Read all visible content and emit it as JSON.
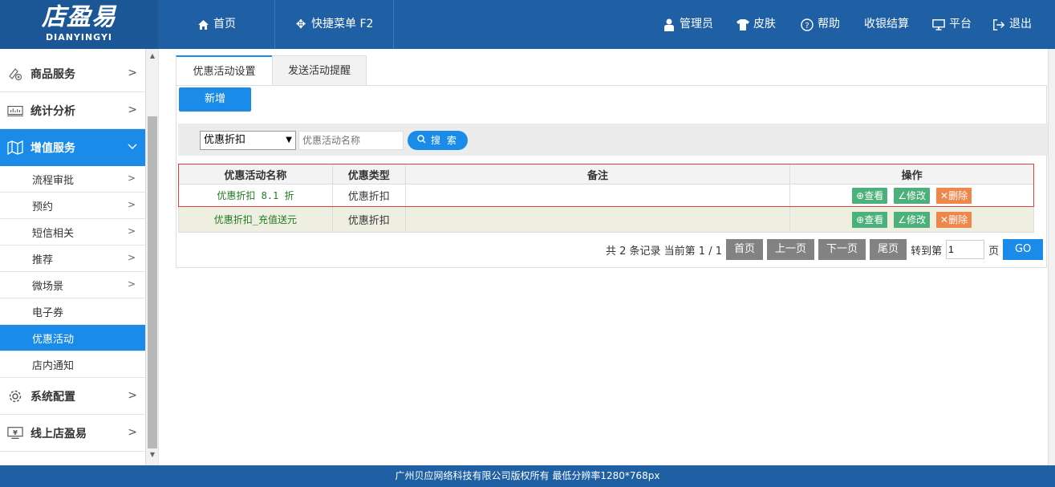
{
  "brand": {
    "logo_cn": "店盈易",
    "logo_en": "DIANYINGYI"
  },
  "topnav": {
    "home": "首页",
    "quick_menu": "快捷菜单 F2",
    "admin": "管理员",
    "skin": "皮肤",
    "help": "帮助",
    "checkout": "收银结算",
    "platform": "平台",
    "logout": "退出"
  },
  "sidebar": {
    "menus": [
      {
        "label": "商品服务",
        "icon": "goods-icon"
      },
      {
        "label": "统计分析",
        "icon": "chart-icon"
      },
      {
        "label": "增值服务",
        "icon": "map-icon"
      },
      {
        "label": "系统配置",
        "icon": "gear-icon"
      },
      {
        "label": "线上店盈易",
        "icon": "monitor-yen-icon"
      }
    ],
    "subs": [
      "流程审批",
      "预约",
      "短信相关",
      "推荐",
      "微场景",
      "电子券",
      "优惠活动",
      "店内通知"
    ]
  },
  "tabs": [
    "优惠活动设置",
    "发送活动提醒"
  ],
  "toolbar": {
    "new_label": "新增"
  },
  "search": {
    "select_value": "优惠折扣",
    "placeholder": "优惠活动名称",
    "button_label": "搜 索"
  },
  "table": {
    "headers": [
      "优惠活动名称",
      "优惠类型",
      "备注",
      "操作"
    ],
    "rows": [
      {
        "name": "优惠折扣 8.1 折",
        "type": "优惠折扣",
        "note": ""
      },
      {
        "name": "优惠折扣_充值送元",
        "type": "优惠折扣",
        "note": ""
      }
    ],
    "actions": {
      "view": "查看",
      "edit": "修改",
      "delete": "删除"
    }
  },
  "pager": {
    "summary": "共 2 条记录 当前第 1 / 1",
    "first": "首页",
    "prev": "上一页",
    "next": "下一页",
    "last": "尾页",
    "goto_label": "转到第",
    "page_value": "1",
    "page_unit": "页",
    "go": "GO"
  },
  "footer": {
    "text": "广州贝应网络科技有限公司版权所有 最低分辨率1280*768px"
  }
}
